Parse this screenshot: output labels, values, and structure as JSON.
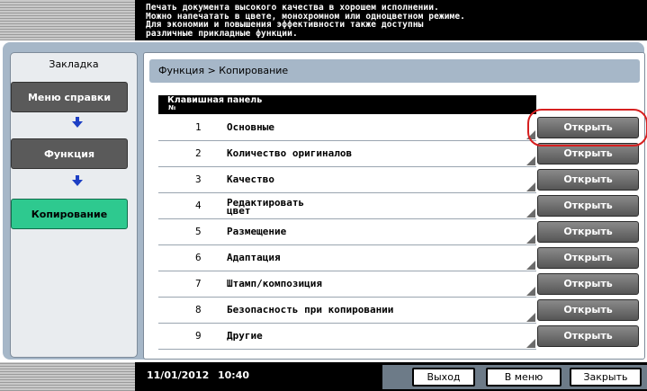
{
  "message": "Печать документа высокого качества в хорошем исполнении.\nМожно напечатать в цвете, монохромном или одноцветном режиме.\nДля экономии и повышения эффективности также доступны\nразличные прикладные функции.",
  "sidebar": {
    "title": "Закладка",
    "items": [
      {
        "label": "Меню справки"
      },
      {
        "label": "Функция"
      },
      {
        "label": "Копирование"
      }
    ]
  },
  "breadcrumb": "Функция > Копирование",
  "list": {
    "header": "Клавишная панель",
    "header_sub": "№",
    "rows": [
      {
        "num": "1",
        "label": "Основные",
        "button": "Открыть"
      },
      {
        "num": "2",
        "label": "Количество оригиналов",
        "button": "Открыть"
      },
      {
        "num": "3",
        "label": "Качество",
        "button": "Открыть"
      },
      {
        "num": "4",
        "label": "Редактировать\nцвет",
        "button": "Открыть"
      },
      {
        "num": "5",
        "label": "Размещение",
        "button": "Открыть"
      },
      {
        "num": "6",
        "label": "Адаптация",
        "button": "Открыть"
      },
      {
        "num": "7",
        "label": "Штамп/композиция",
        "button": "Открыть"
      },
      {
        "num": "8",
        "label": "Безопасность при копировании",
        "button": "Открыть"
      },
      {
        "num": "9",
        "label": "Другие",
        "button": "Открыть"
      }
    ]
  },
  "footer": {
    "date": "11/01/2012",
    "time": "10:40",
    "buttons": [
      {
        "label": "Выход"
      },
      {
        "label": "В меню"
      },
      {
        "label": "Закрыть"
      }
    ]
  },
  "colors": {
    "active": "#2ec98f",
    "panel": "#a6b7c8",
    "highlight": "#d62020"
  }
}
